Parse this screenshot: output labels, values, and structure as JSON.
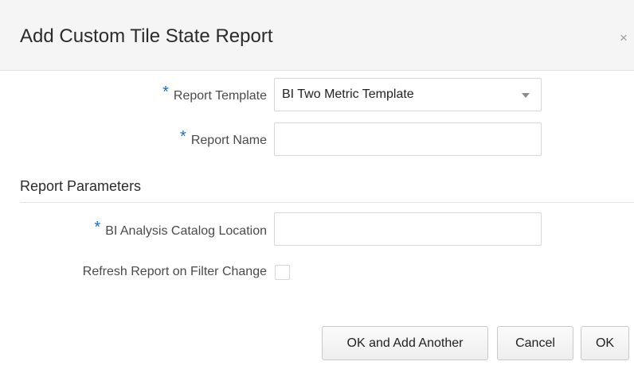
{
  "dialog": {
    "title": "Add Custom Tile State Report",
    "close_glyph": "×",
    "close_icon": "close-icon"
  },
  "form": {
    "required_marker": "*",
    "report_template": {
      "label": "Report Template",
      "value": "BI Two Metric Template",
      "required": true
    },
    "report_name": {
      "label": "Report Name",
      "value": "",
      "required": true
    }
  },
  "parameters": {
    "section_title": "Report Parameters",
    "catalog_location": {
      "label": "BI Analysis Catalog Location",
      "value": "",
      "required": true
    },
    "refresh_on_filter": {
      "label": "Refresh Report on Filter Change",
      "checked": false
    }
  },
  "footer": {
    "ok_add_another_label": "OK and Add Another",
    "cancel_label": "Cancel",
    "ok_label": "OK"
  },
  "colors": {
    "required_marker": "#1a6fb5",
    "header_bg": "#f5f5f5",
    "border": "#d6d6d6"
  }
}
